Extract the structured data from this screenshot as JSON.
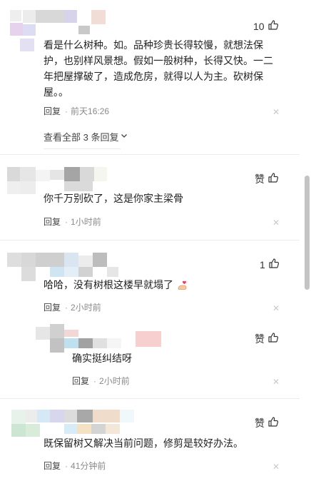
{
  "comments": [
    {
      "text": "看是什么树种。如。品种珍贵长得较慢，就想法保护，也别样风景想。假如一般树种，长得又快。一二年把屋撑破了，造成危房，就得以人为主。砍树保屋。。",
      "reply_label": "回复",
      "time": "前天16:26",
      "likes": "10",
      "view_all": "查看全部 3 条回复"
    },
    {
      "text": "你千万别砍了，这是你家主梁骨",
      "reply_label": "回复",
      "time": "1小时前",
      "likes": "赞"
    },
    {
      "text": "哈哈，没有树根这楼早就塌了",
      "reply_label": "回复",
      "time": "2小时前",
      "likes": "1",
      "replies": [
        {
          "text": "确实挺纠结呀",
          "reply_label": "回复",
          "time": "2小时前",
          "likes": "赞"
        }
      ]
    },
    {
      "text": "既保留树又解决当前问题，修剪是较好办法。",
      "reply_label": "回复",
      "time": "41分钟前",
      "likes": "赞"
    }
  ],
  "icons": {
    "like": "thumbs-up-icon",
    "close": "close-icon",
    "expand": "chevron-down-icon",
    "emoji": "flexed-arm-heart-emoji"
  },
  "colors": {
    "text": "#222222",
    "meta": "#8a8a8a",
    "divider": "#ececec",
    "scrollbar": "#c4c4c4"
  }
}
